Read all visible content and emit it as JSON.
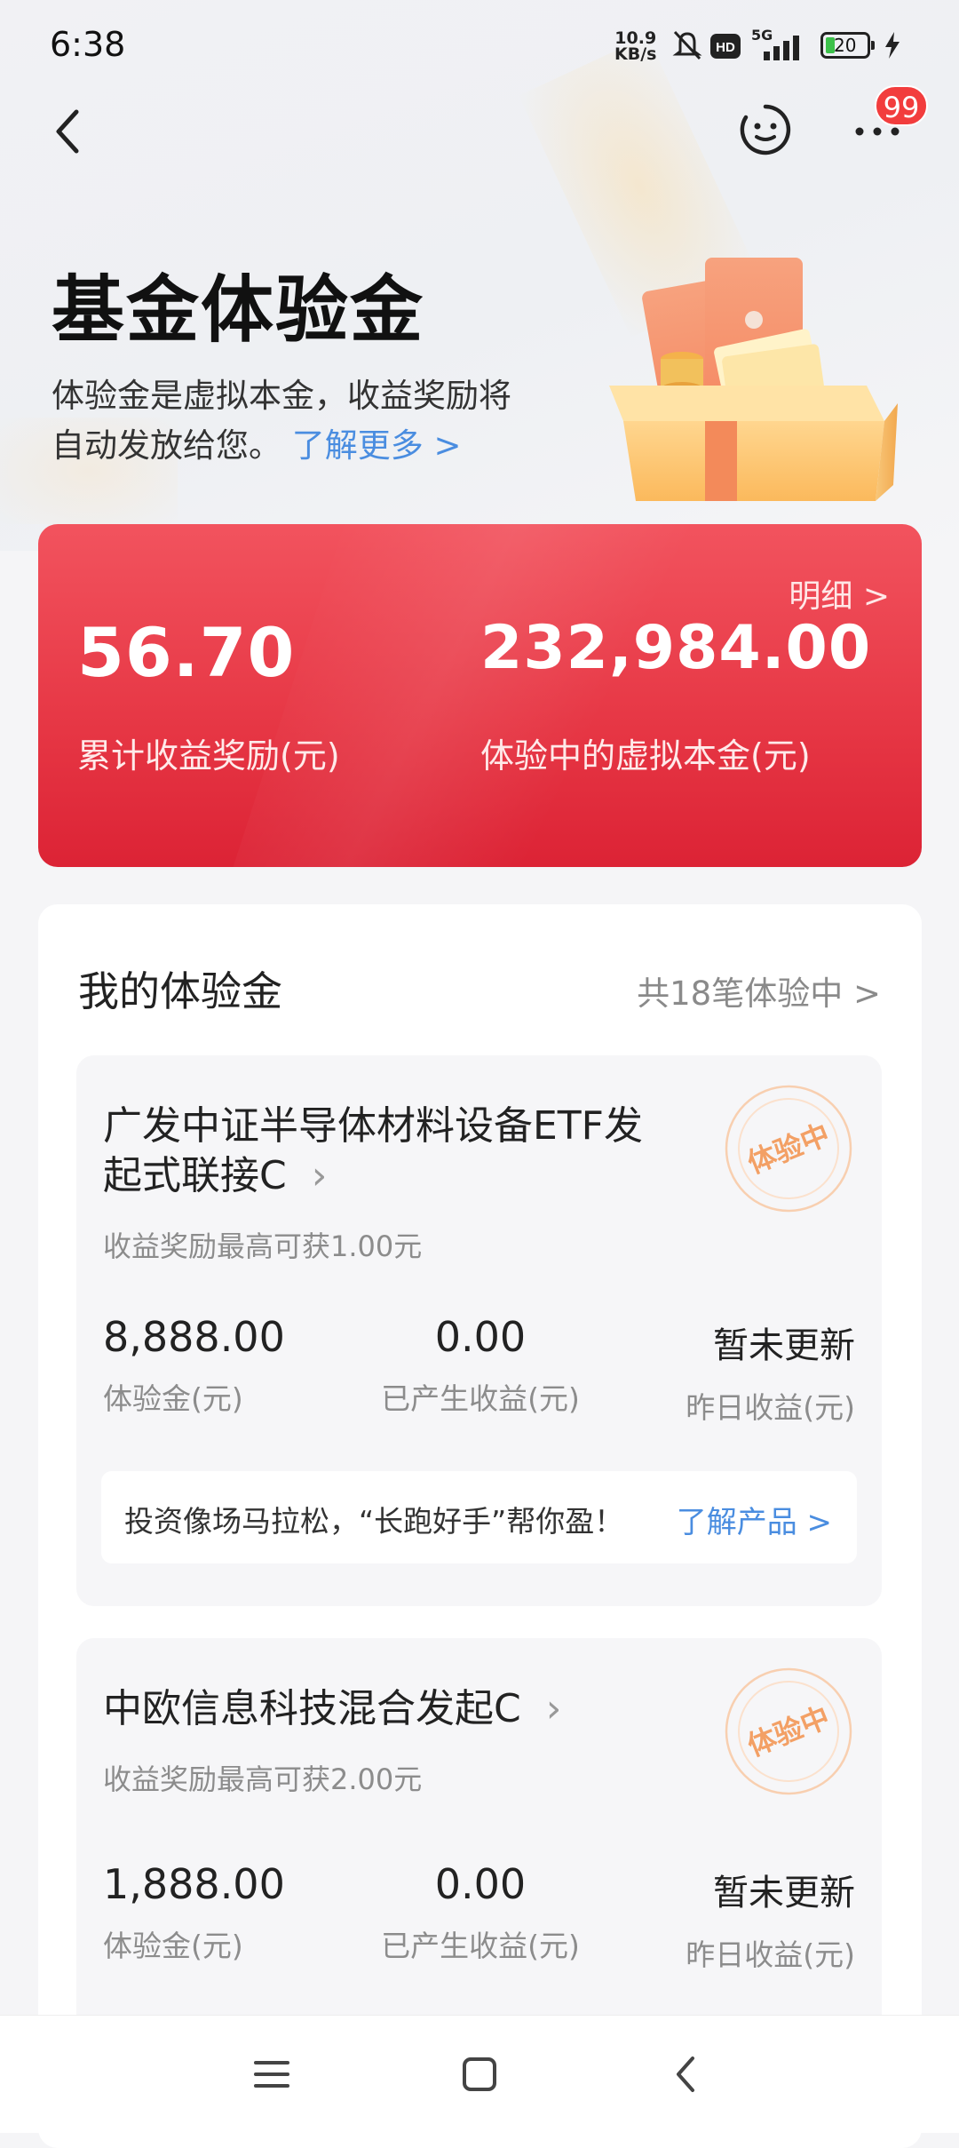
{
  "status": {
    "time": "6:38",
    "net_speed_value": "10.9",
    "net_speed_unit": "KB/s",
    "signal": "5G",
    "battery": "20"
  },
  "nav": {
    "badge_count": "99"
  },
  "header": {
    "title": "基金体验金",
    "intro_line1": "体验金是虚拟本金，收益奖励将",
    "intro_line2": "自动发放给您。",
    "learn_more": "了解更多 >"
  },
  "summary": {
    "detail_link": "明细 >",
    "total_reward_value": "56.70",
    "total_reward_label": "累计收益奖励(元)",
    "virtual_principal_value": "232,984.00",
    "virtual_principal_label": "体验中的虚拟本金(元)"
  },
  "my_funds": {
    "title": "我的体验金",
    "count_link": "共18笔体验中 >",
    "items": [
      {
        "name": "广发中证半导体材料设备ETF发起式联接C",
        "reward_note": "收益奖励最高可获1.00元",
        "stamp": "体验中",
        "amount_value": "8,888.00",
        "amount_label": "体验金(元)",
        "earned_value": "0.00",
        "earned_label": "已产生收益(元)",
        "yesterday_value": "暂未更新",
        "yesterday_label": "昨日收益(元)",
        "promo_text": "投资像场马拉松，“长跑好手”帮你盈！",
        "promo_link": "了解产品 >"
      },
      {
        "name": "中欧信息科技混合发起C",
        "reward_note": "收益奖励最高可获2.00元",
        "stamp": "体验中",
        "amount_value": "1,888.00",
        "amount_label": "体验金(元)",
        "earned_value": "0.00",
        "earned_label": "已产生收益(元)",
        "yesterday_value": "暂未更新",
        "yesterday_label": "昨日收益(元)"
      }
    ]
  },
  "colors": {
    "accent_red": "#e63644",
    "link_blue": "#4a8de0",
    "stamp_orange": "#f3a065"
  },
  "icons": [
    "back-icon",
    "face-icon",
    "more-icon",
    "menu-icon",
    "home-icon",
    "nav-back-icon",
    "chevron-right-icon",
    "bell-muted-icon",
    "hd-icon",
    "signal-icon",
    "battery-icon",
    "charging-icon"
  ]
}
